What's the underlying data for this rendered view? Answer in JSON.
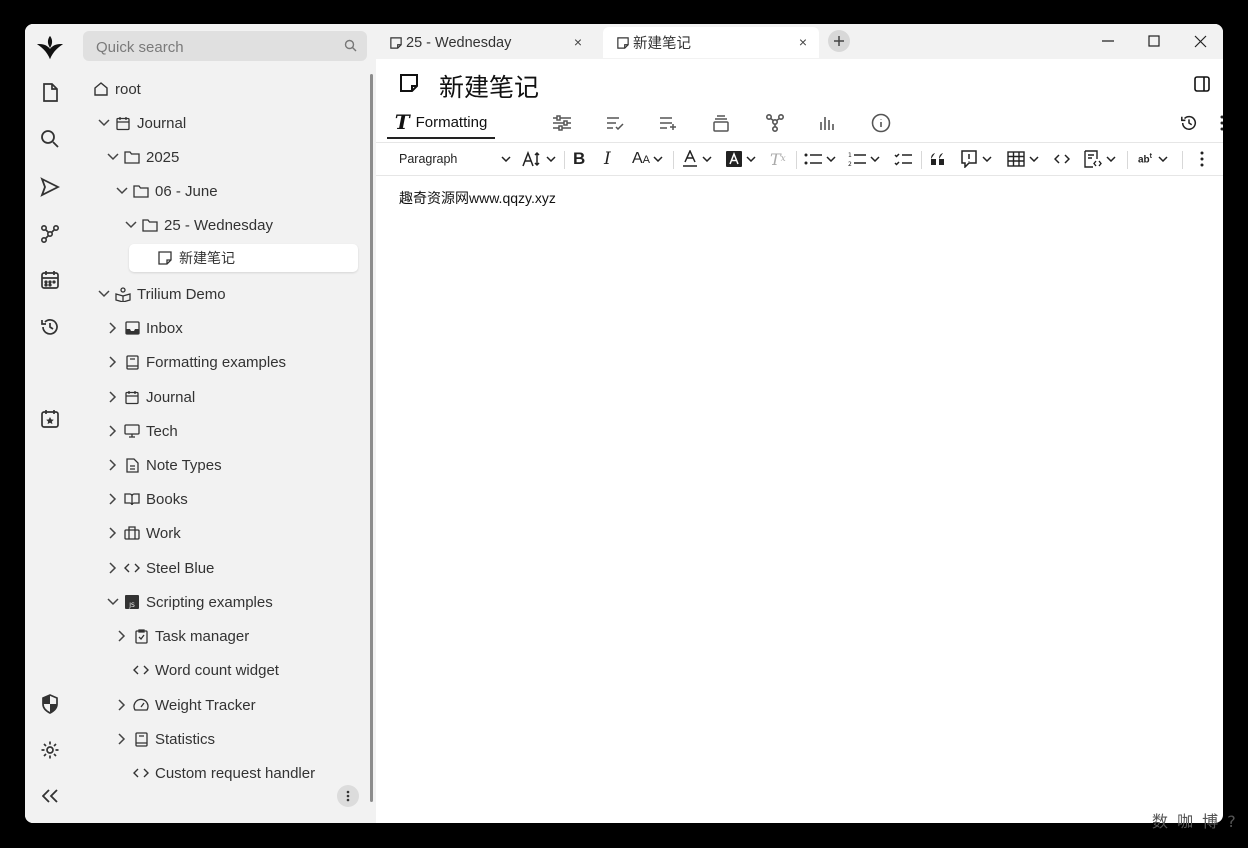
{
  "search": {
    "placeholder": "Quick search"
  },
  "tree": {
    "root": "root",
    "journal": "Journal",
    "year": "2025",
    "month": "06 - June",
    "day": "25 - Wednesday",
    "note": "新建笔记",
    "demo": "Trilium Demo",
    "demo_children": [
      "Inbox",
      "Formatting examples",
      "Journal",
      "Tech",
      "Note Types",
      "Books",
      "Work",
      "Steel Blue",
      "Scripting examples"
    ],
    "scripting_children": [
      "Task manager",
      "Word count widget",
      "Weight Tracker",
      "Statistics",
      "Custom request handler"
    ]
  },
  "tabs": [
    {
      "title": "25 - Wednesday",
      "close": "×"
    },
    {
      "title": "新建笔记",
      "close": "×"
    }
  ],
  "note": {
    "title": "新建笔记",
    "body": "趣奇资源网www.qqzy.xyz"
  },
  "ribbon": {
    "formatting_label": "Formatting"
  },
  "toolbar": {
    "paragraph": "Paragraph"
  },
  "watermark": "数 咖 博 ?",
  "colors": {
    "background": "#f2f2f2",
    "active": "#ffffff",
    "text": "#2b2b2b"
  }
}
